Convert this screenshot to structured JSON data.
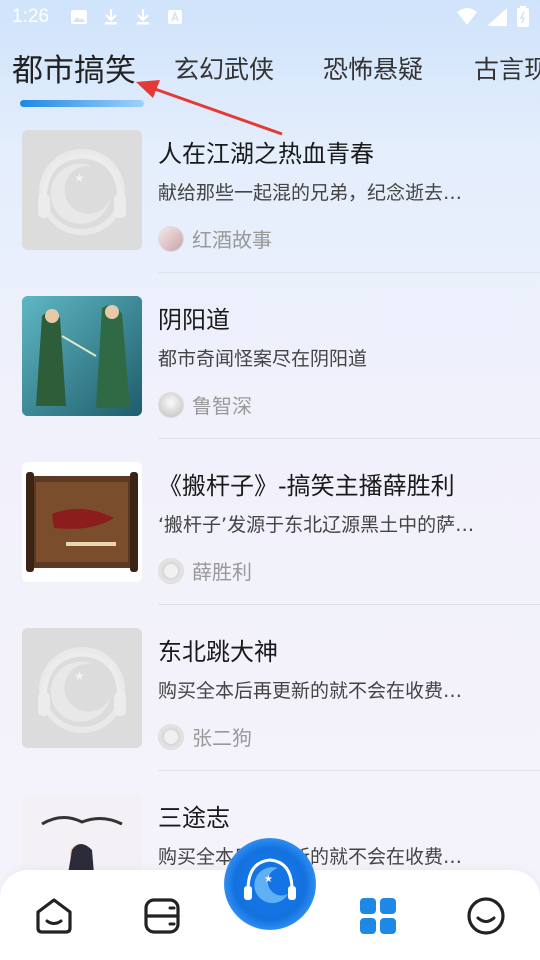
{
  "status_bar": {
    "time": "1:26"
  },
  "tabs": [
    {
      "label": "都市搞笑",
      "active": true
    },
    {
      "label": "玄幻武侠",
      "active": false
    },
    {
      "label": "恐怖悬疑",
      "active": false
    },
    {
      "label": "古言现",
      "active": false
    }
  ],
  "books": [
    {
      "title": "人在江湖之热血青春",
      "description": "献给那些一起混的兄弟，纪念逝去…",
      "author": "红酒故事",
      "cover": "placeholder-headphone"
    },
    {
      "title": "阴阳道",
      "description": "都市奇闻怪案尽在阴阳道",
      "author": "鲁智深",
      "cover": "illustration-two-figures"
    },
    {
      "title": "《搬杆子》-搞笑主播薛胜利",
      "description": "‘搬杆子’发源于东北辽源黑土中的萨…",
      "author": "薛胜利",
      "cover": "scroll-banner"
    },
    {
      "title": "东北跳大神",
      "description": "购买全本后再更新的就不会在收费…",
      "author": "张二狗",
      "cover": "placeholder-headphone"
    },
    {
      "title": "三途志",
      "description": "购买全本后再更新的就不会在收费…",
      "author": "",
      "cover": "illustration-swordsman"
    }
  ],
  "colors": {
    "accent": "#1e88e5",
    "annotation": "#e53935"
  },
  "bottom_nav": {
    "items": [
      "home-icon",
      "bookshelf-icon",
      "player-icon",
      "category-icon",
      "profile-icon"
    ],
    "active": "category-icon"
  }
}
